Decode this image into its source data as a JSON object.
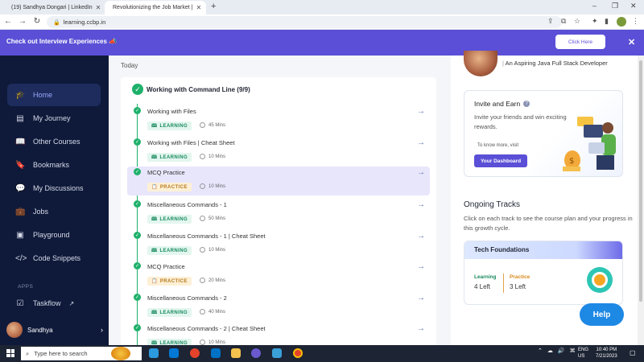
{
  "browser": {
    "tabs": [
      {
        "label": "(19) Sandhya Dongari | LinkedIn",
        "active": false
      },
      {
        "label": "Revolutionizing the Job Market |",
        "active": true
      }
    ],
    "url": "learning.ccbp.in"
  },
  "promo": {
    "text": "Check out Interview Experiences",
    "button": "Click Here"
  },
  "sidebar": {
    "items": [
      {
        "label": "Home",
        "icon": "graduation-cap-icon",
        "active": true
      },
      {
        "label": "My Journey",
        "icon": "journey-icon",
        "active": false
      },
      {
        "label": "Other Courses",
        "icon": "book-icon",
        "active": false
      },
      {
        "label": "Bookmarks",
        "icon": "bookmark-icon",
        "active": false
      },
      {
        "label": "My Discussions",
        "icon": "chat-icon",
        "active": false
      },
      {
        "label": "Jobs",
        "icon": "briefcase-icon",
        "active": false
      },
      {
        "label": "Playground",
        "icon": "terminal-icon",
        "active": false
      },
      {
        "label": "Code Snippets",
        "icon": "code-icon",
        "active": false
      }
    ],
    "apps_label": "APPS",
    "taskflow": "Taskflow",
    "user": "Sandhya"
  },
  "main": {
    "today": "Today",
    "module_title": "Working with Command Line (9/9)",
    "rows": [
      {
        "title": "Working with Files",
        "type": "LEARNING",
        "duration": "45 Mins"
      },
      {
        "title": "Working with Files | Cheat Sheet",
        "type": "LEARNING",
        "duration": "10 Mins"
      },
      {
        "title": "MCQ Practice",
        "type": "PRACTICE",
        "duration": "10 Mins"
      },
      {
        "title": "Miscellaneous Commands - 1",
        "type": "LEARNING",
        "duration": "50 Mins"
      },
      {
        "title": "Miscellaneous Commands - 1 | Cheat Sheet",
        "type": "LEARNING",
        "duration": "10 Mins"
      },
      {
        "title": "MCQ Practice",
        "type": "PRACTICE",
        "duration": "20 Mins"
      },
      {
        "title": "Miscellaneous Commands - 2",
        "type": "LEARNING",
        "duration": "40 Mins"
      },
      {
        "title": "Miscellaneous Commands - 2 | Cheat Sheet",
        "type": "LEARNING",
        "duration": "10 Mins"
      }
    ]
  },
  "right": {
    "profile_subtitle": "An Aspiring Java Full Stack Developer",
    "invite": {
      "title": "Invite and Earn",
      "text": "Invite your friends and win exciting rewards.",
      "know_more": "To know more, visit",
      "button": "Your Dashboard"
    },
    "ongoing_title": "Ongoing Tracks",
    "ongoing_text": "Click on each track to see the course plan and your progress in this growth cycle.",
    "track": {
      "name": "Tech Foundations",
      "learning_label": "Learning",
      "learning_value": "4 Left",
      "practice_label": "Practice",
      "practice_value": "3 Left"
    },
    "help": "Help"
  },
  "taskbar": {
    "search_placeholder": "Type here to search",
    "lang": "ENG",
    "region": "US",
    "time": "10:40 PM",
    "date": "7/21/2023"
  },
  "colors": {
    "accent": "#5a4fd6",
    "success": "#1fb16b",
    "sidebar": "#0f1a3a",
    "help": "#1e88e5"
  }
}
